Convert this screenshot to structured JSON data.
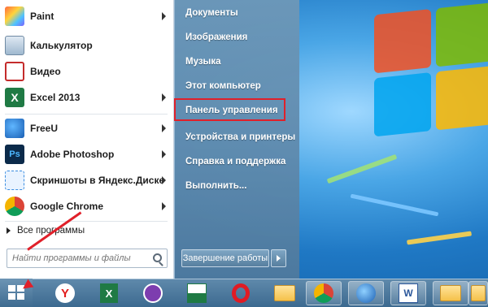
{
  "programs": [
    {
      "label": "Paint",
      "icon": "paint-icon",
      "arrow": true
    },
    {
      "label": "Калькулятор",
      "icon": "calculator-icon",
      "arrow": false
    },
    {
      "label": "Видео",
      "icon": "video-icon",
      "arrow": false
    },
    {
      "label": "Excel 2013",
      "icon": "excel-icon",
      "arrow": true
    },
    {
      "label": "FreeU",
      "icon": "freeu-icon",
      "arrow": true
    },
    {
      "label": "Adobe Photoshop",
      "icon": "photoshop-icon",
      "arrow": true
    },
    {
      "label": "Скриншоты в Яндекс.Диске",
      "icon": "yandex-disk-screenshot-icon",
      "arrow": true
    },
    {
      "label": "Google Chrome",
      "icon": "chrome-icon",
      "arrow": true
    }
  ],
  "all_programs": "Все программы",
  "search": {
    "placeholder": "Найти программы и файлы"
  },
  "right_links": [
    {
      "label": "Документы"
    },
    {
      "label": "Изображения"
    },
    {
      "label": "Музыка"
    },
    {
      "label": "Этот компьютер"
    },
    {
      "label": "Панель управления",
      "highlighted": true
    },
    {
      "label": "Устройства и принтеры"
    },
    {
      "label": "Справка и поддержка"
    },
    {
      "label": "Выполнить..."
    }
  ],
  "shutdown_label": "Завершение работы",
  "colors": {
    "highlight": "#e0202a",
    "menu_right": "#5f8aad",
    "taskbar": "#3c6a90"
  },
  "taskbar_items": [
    {
      "icon": "yandex-browser-icon"
    },
    {
      "icon": "excel-icon"
    },
    {
      "icon": "viber-icon"
    },
    {
      "icon": "excel-file-icon"
    },
    {
      "icon": "opera-icon"
    },
    {
      "icon": "folder-icon"
    },
    {
      "icon": "chrome-icon",
      "open": true
    },
    {
      "icon": "freeu-icon",
      "open": true
    },
    {
      "icon": "word-icon",
      "open": true
    },
    {
      "icon": "folder-icon",
      "open": true
    },
    {
      "icon": "folder-icon",
      "open": true
    }
  ]
}
